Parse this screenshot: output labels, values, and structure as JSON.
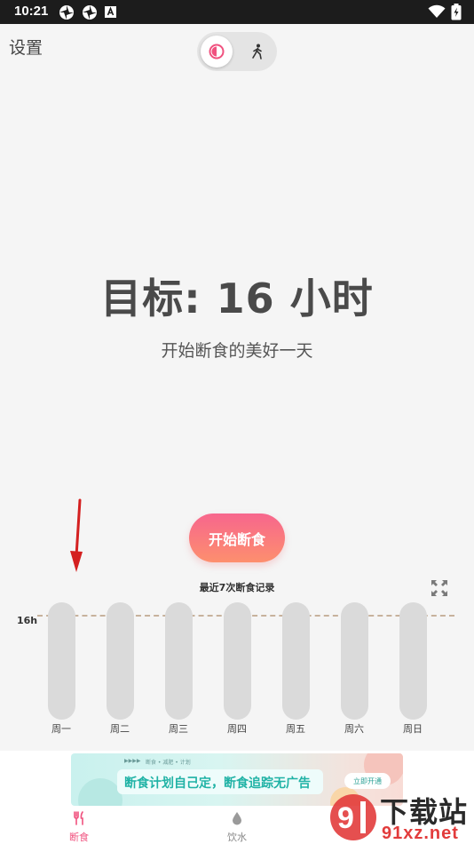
{
  "status_bar": {
    "time": "10:21",
    "icons": [
      "pinwheel-icon",
      "pinwheel-icon",
      "a-box-icon",
      "wifi-icon",
      "battery-charging-icon"
    ]
  },
  "header": {
    "settings_label": "设置",
    "mode_toggle": {
      "options": [
        "fasting-moon-icon",
        "walking-icon"
      ],
      "active": "fasting-moon-icon"
    }
  },
  "goal": {
    "title": "目标: 16 小时",
    "subtitle": "开始断食的美好一天"
  },
  "start_button_label": "开始断食",
  "history": {
    "title": "最近7次断食记录",
    "target_label": "16h",
    "days": [
      "周一",
      "周二",
      "周三",
      "周四",
      "周五",
      "周六",
      "周日"
    ]
  },
  "ad": {
    "top_left": "▶▶▶▶",
    "top_right": "断食 • 减肥 • 计划",
    "text": "断食计划自己定，断食追踪无广告",
    "cta": "立即开通"
  },
  "bottom_nav": {
    "items": [
      {
        "label": "断食",
        "icon": "fork-knife-icon",
        "active": true
      },
      {
        "label": "饮水",
        "icon": "water-drop-icon",
        "active": false
      }
    ]
  },
  "watermark": {
    "line1": "下载站",
    "line2": "91xz.net"
  },
  "colors": {
    "accent": "#f0527f",
    "button_gradient_start": "#f7668d",
    "button_gradient_end": "#fd8f6e",
    "bar": "#dadada",
    "target_line": "#c7b29c",
    "arrow": "#d42020"
  }
}
